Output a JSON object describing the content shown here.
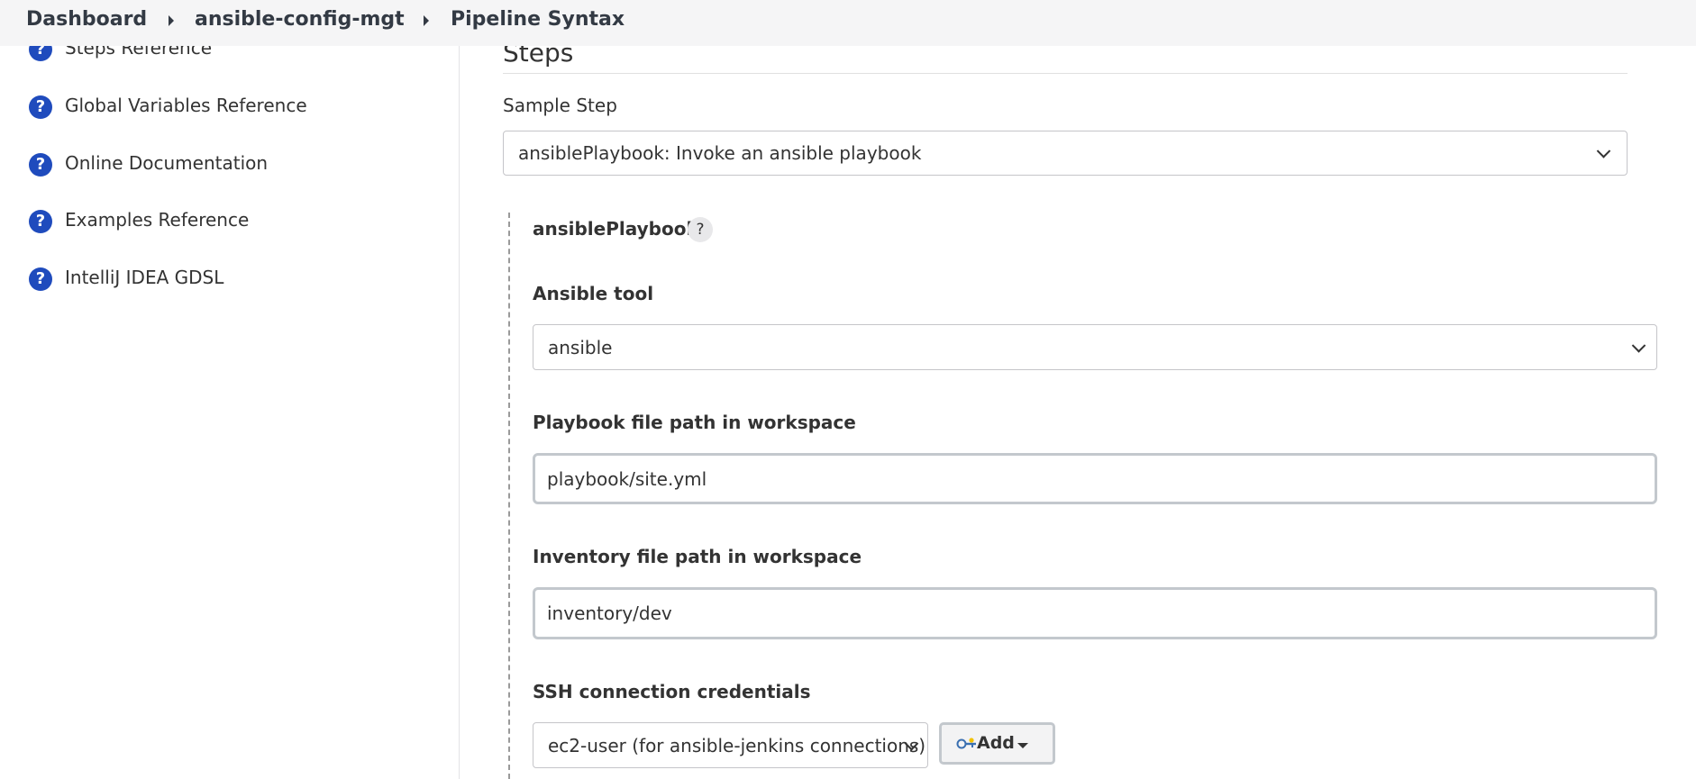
{
  "breadcrumb": {
    "items": [
      "Dashboard",
      "ansible-config-mgt",
      "Pipeline Syntax"
    ]
  },
  "sidebar": {
    "items": [
      {
        "label": "Steps Reference",
        "icon": "help-icon"
      },
      {
        "label": "Global Variables Reference",
        "icon": "help-icon"
      },
      {
        "label": "Online Documentation",
        "icon": "help-icon"
      },
      {
        "label": "Examples Reference",
        "icon": "help-icon"
      },
      {
        "label": "IntelliJ IDEA GDSL",
        "icon": "help-icon"
      }
    ]
  },
  "main": {
    "section_title": "Steps",
    "sample_step": {
      "label": "Sample Step",
      "value": "ansiblePlaybook: Invoke an ansible playbook"
    },
    "step_name": "ansiblePlaybook",
    "help_glyph": "?",
    "ansible_tool": {
      "label": "Ansible tool",
      "value": "ansible"
    },
    "playbook_path": {
      "label": "Playbook file path in workspace",
      "value": "playbook/site.yml"
    },
    "inventory_path": {
      "label": "Inventory file path in workspace",
      "value": "inventory/dev"
    },
    "ssh_credentials": {
      "label": "SSH connection credentials",
      "value": "ec2-user (for ansible-jenkins connections)",
      "add_label": "Add"
    }
  },
  "colors": {
    "accent": "#1f4bbd",
    "breadcrumb_bg": "#f5f5f6",
    "text": "#333333"
  }
}
